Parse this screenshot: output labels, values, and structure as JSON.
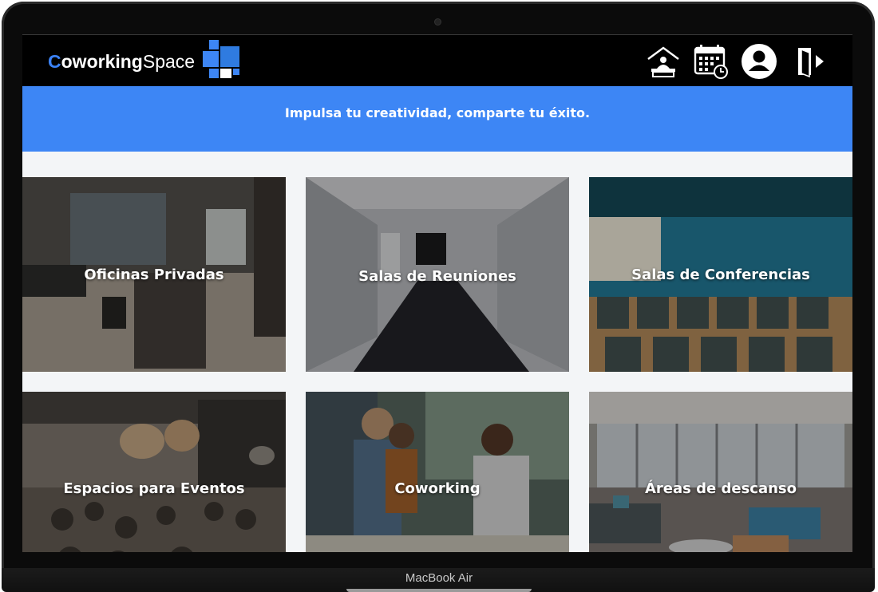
{
  "device": {
    "label": "MacBook Air"
  },
  "header": {
    "logo": {
      "letter": "C",
      "word1": "oworking",
      "word2": "Space"
    },
    "icons": [
      "home-desk-icon",
      "calendar-icon",
      "user-profile-icon",
      "logout-door-icon"
    ]
  },
  "banner": {
    "text": "Impulsa tu creatividad, comparte tu éxito."
  },
  "cards": [
    {
      "label": "Oficinas Privadas"
    },
    {
      "label": "Salas de Reuniones"
    },
    {
      "label": "Salas de Conferencias"
    },
    {
      "label": "Espacios para Eventos"
    },
    {
      "label": "Coworking"
    },
    {
      "label": "Áreas de descanso"
    }
  ],
  "colors": {
    "accent": "#3d86f5",
    "header": "#000000",
    "background": "#f3f5f7"
  }
}
